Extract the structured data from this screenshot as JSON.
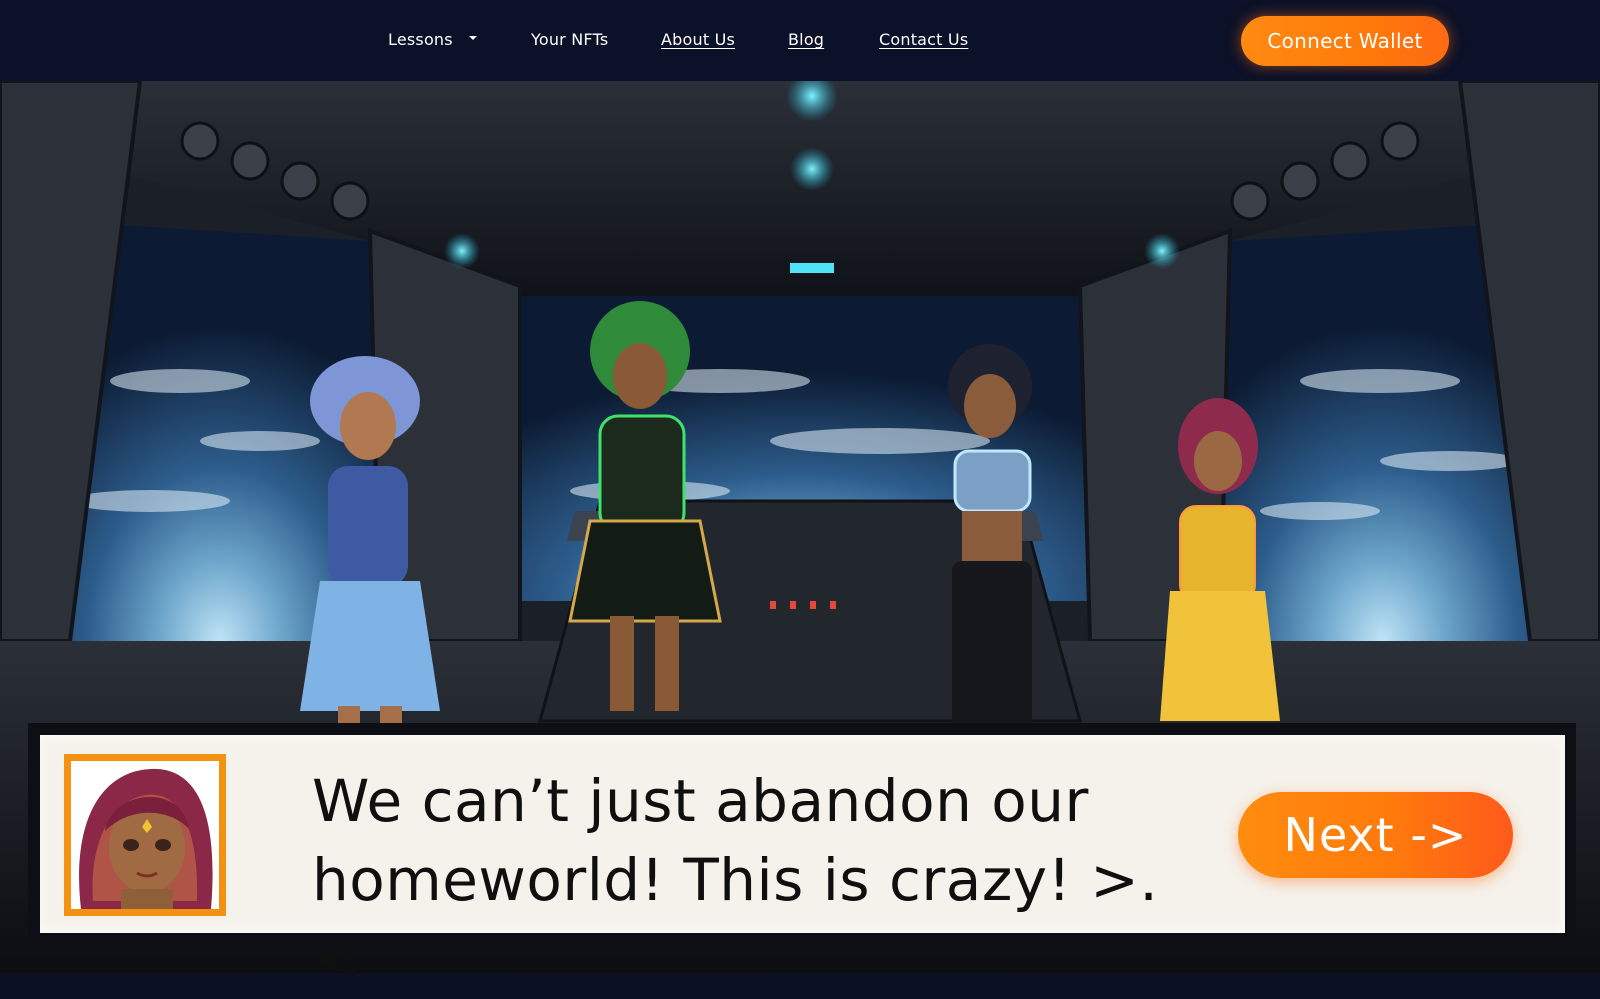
{
  "nav": {
    "items": [
      {
        "label": "Lessons",
        "has_dropdown": true,
        "underlined": false
      },
      {
        "label": "Your NFTs",
        "has_dropdown": false,
        "underlined": false
      },
      {
        "label": "About Us",
        "has_dropdown": false,
        "underlined": true
      },
      {
        "label": "Blog",
        "has_dropdown": false,
        "underlined": true
      },
      {
        "label": "Contact Us",
        "has_dropdown": false,
        "underlined": true
      }
    ],
    "connect_wallet_label": "Connect Wallet"
  },
  "scene": {
    "setting": "spaceship-bridge",
    "characters": [
      "blue-haired-character",
      "green-haired-character",
      "black-haired-character",
      "pink-haired-character"
    ]
  },
  "dialog": {
    "speaker_icon": "pink-haired-character-portrait",
    "lines": [
      "We can’t just abandon our",
      "homeworld! This is crazy! >.<"
    ],
    "next_label": "Next ->"
  },
  "colors": {
    "nav_bg": "#0b1128",
    "accent": "#ff7a0c",
    "dialog_bg": "#f5f2eb",
    "portrait_border": "#f39113"
  }
}
